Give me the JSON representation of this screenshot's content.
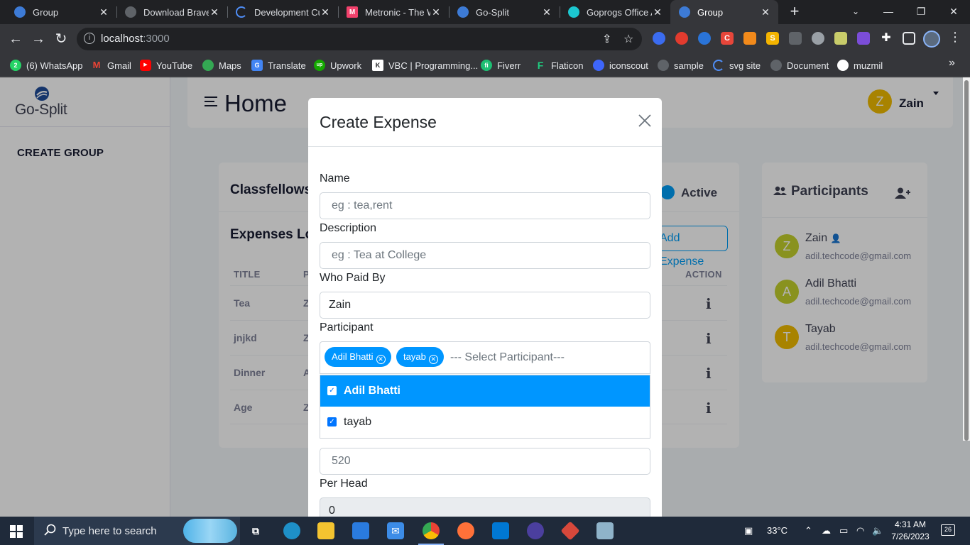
{
  "browser": {
    "tabs": [
      {
        "title": "Group",
        "icon": "gosplit-icon",
        "color": "#3d7bd6",
        "active": false
      },
      {
        "title": "Download Brave",
        "icon": "globe-icon",
        "color": "#9aa0a6",
        "active": false
      },
      {
        "title": "Development Cu",
        "icon": "loading-icon",
        "color": "#4f8ef7",
        "active": false
      },
      {
        "title": "Metronic - The W",
        "icon": "metronic-icon",
        "color": "#f1416c",
        "active": false
      },
      {
        "title": "Go-Split",
        "icon": "gosplit-icon",
        "color": "#3d7bd6",
        "active": false
      },
      {
        "title": "Goprogs Office A",
        "icon": "goprogs-icon",
        "color": "#1cc7d0",
        "active": false
      },
      {
        "title": "Group",
        "icon": "gosplit-icon",
        "color": "#3d7bd6",
        "active": true
      }
    ],
    "url_host": "localhost",
    "url_port": ":3000",
    "bookmarks": [
      {
        "label": "(6) WhatsApp",
        "icon": "whatsapp-icon",
        "color": "#25d366"
      },
      {
        "label": "Gmail",
        "icon": "gmail-icon",
        "color": "#ea4335"
      },
      {
        "label": "YouTube",
        "icon": "youtube-icon",
        "color": "#ff0000"
      },
      {
        "label": "Maps",
        "icon": "maps-icon",
        "color": "#34a853"
      },
      {
        "label": "Translate",
        "icon": "translate-icon",
        "color": "#4285f4"
      },
      {
        "label": "Upwork",
        "icon": "upwork-icon",
        "color": "#14a800"
      },
      {
        "label": "VBC | Programming...",
        "icon": "vbc-icon",
        "color": "#ffffff"
      },
      {
        "label": "Fiverr",
        "icon": "fiverr-icon",
        "color": "#1dbf73"
      },
      {
        "label": "Flaticon",
        "icon": "flaticon-icon",
        "color": "#1fcc7f"
      },
      {
        "label": "iconscout",
        "icon": "iconscout-icon",
        "color": "#3e66fb"
      },
      {
        "label": "sample",
        "icon": "globe-icon",
        "color": "#9aa0a6"
      },
      {
        "label": "svg site",
        "icon": "loading-icon",
        "color": "#4f8ef7"
      },
      {
        "label": "Document",
        "icon": "globe-icon",
        "color": "#9aa0a6"
      },
      {
        "label": "muzmil",
        "icon": "github-icon",
        "color": "#ffffff"
      }
    ]
  },
  "app": {
    "logo_text": "Go-Split",
    "sidebar_link": "CREATE GROUP",
    "page_title": "Home",
    "user": {
      "initial": "Z",
      "name": "Zain"
    },
    "group": {
      "name": "Classfellows",
      "status": "Active"
    },
    "expenses": {
      "title": "Expenses Log",
      "add_button": "Add Expense",
      "columns": [
        "TITLE",
        "P",
        "ACTION"
      ],
      "rows": [
        {
          "title": "Tea",
          "payer": "Z"
        },
        {
          "title": "jnjkd",
          "payer": "Z"
        },
        {
          "title": "Dinner",
          "payer": "A"
        },
        {
          "title": "Age",
          "payer": "Z"
        }
      ]
    },
    "participants": {
      "title": "Participants",
      "list": [
        {
          "initial": "Z",
          "name": "Zain",
          "email": "adil.techcode@gmail.com",
          "color": "#c5d12d",
          "admin": true
        },
        {
          "initial": "A",
          "name": "Adil Bhatti",
          "email": "adil.techcode@gmail.com",
          "color": "#c5d12d",
          "admin": false
        },
        {
          "initial": "T",
          "name": "Tayab",
          "email": "adil.techcode@gmail.com",
          "color": "#f1bc00",
          "admin": false
        }
      ]
    }
  },
  "modal": {
    "title": "Create Expense",
    "name_label": "Name",
    "name_placeholder": "eg : tea,rent",
    "description_label": "Description",
    "description_placeholder": "eg : Tea at College",
    "paid_by_label": "Who Paid By",
    "paid_by_value": "Zain",
    "participant_label": "Participant",
    "chips": [
      "Adil Bhatti",
      "tayab"
    ],
    "participant_placeholder": "--- Select Participant---",
    "options": [
      {
        "label": "Adil Bhatti",
        "checked": true,
        "highlighted": true
      },
      {
        "label": "tayab",
        "checked": true,
        "highlighted": false
      }
    ],
    "amount_placeholder": "520",
    "per_head_label": "Per Head",
    "per_head_value": "0"
  },
  "taskbar": {
    "search_placeholder": "Type here to search",
    "temperature": "33°C",
    "time": "4:31 AM",
    "date": "7/26/2023",
    "notifications": "26"
  }
}
